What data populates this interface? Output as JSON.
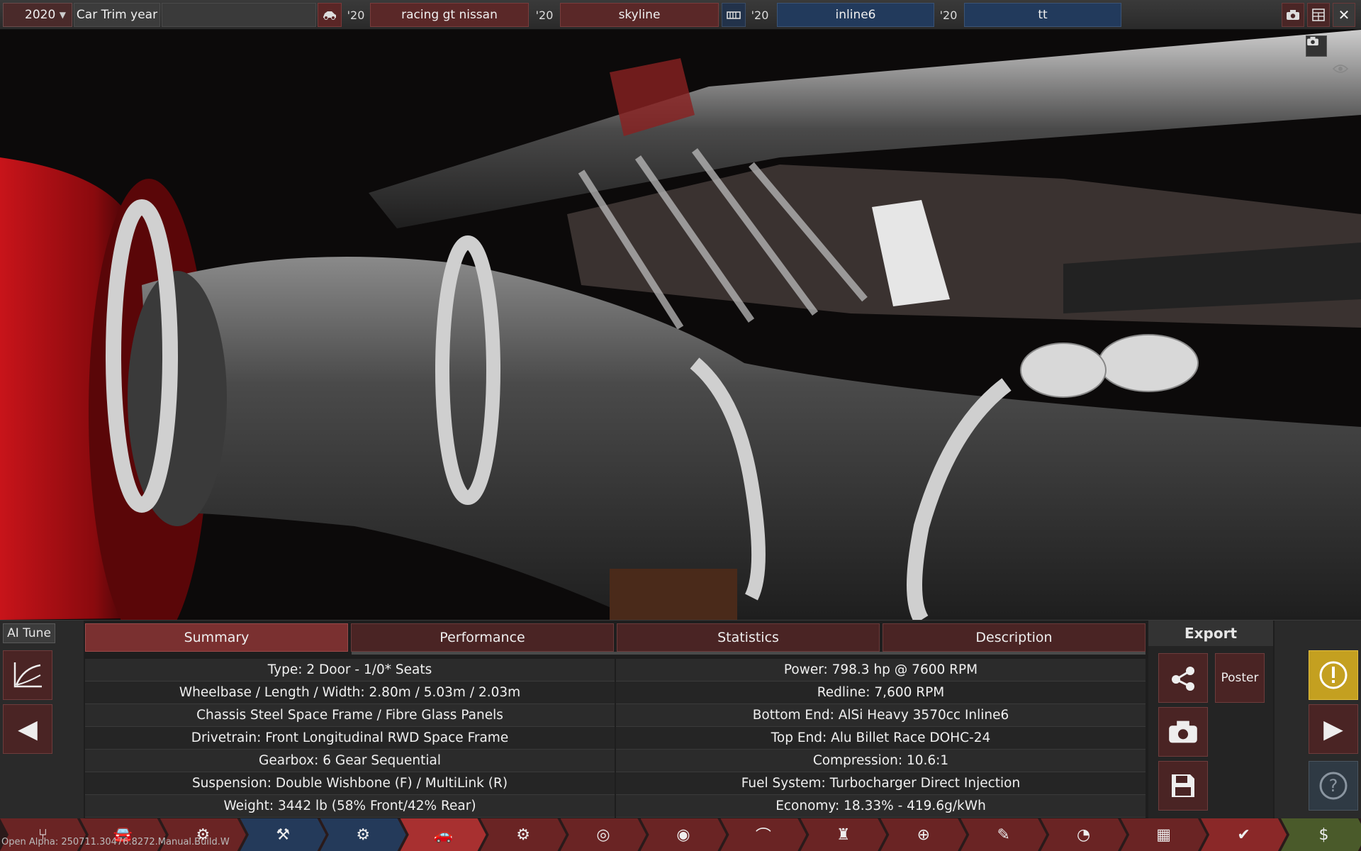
{
  "topbar": {
    "year_value": "2020",
    "field_label": "Car Trim year",
    "model_year_1": "'20",
    "model_name": "racing gt nissan",
    "trim_year_2": "'20",
    "trim_name": "skyline",
    "engine_year_1": "'20",
    "engine_name": "inline6",
    "variant_year": "'20",
    "variant_name": "tt",
    "icons": [
      "car-icon",
      "engine-icon",
      "camera-icon",
      "calculator-icon",
      "close-icon"
    ]
  },
  "scene": {
    "icons": [
      "camera-icon",
      "eye-icon"
    ]
  },
  "panel": {
    "ai_tune_label": "AI Tune",
    "tabs": [
      "Summary",
      "Performance",
      "Statistics",
      "Description"
    ],
    "active_tab": "Summary",
    "left_stats": [
      "Type: 2 Door - 1/0* Seats",
      "Wheelbase / Length / Width: 2.80m / 5.03m / 2.03m",
      "Chassis Steel Space Frame / Fibre Glass Panels",
      "Drivetrain: Front Longitudinal RWD Space Frame",
      "Gearbox: 6 Gear Sequential",
      "Suspension: Double Wishbone (F) / MultiLink (R)",
      "Weight: 3442 lb (58% Front/42% Rear)"
    ],
    "right_stats": [
      "Power: 798.3 hp @ 7600 RPM",
      "Redline:  7,600 RPM",
      "Bottom End: AlSi Heavy 3570cc Inline6",
      "Top End: Alu Billet Race DOHC-24",
      "Compression: 10.6:1",
      "Fuel System: Turbocharger Direct Injection",
      "Economy: 18.33% - 419.6g/kWh"
    ],
    "export_title": "Export",
    "poster_label": "Poster"
  },
  "build_info": "Open Alpha: 250711.30476.8272.Manual.Build.W",
  "colors": {
    "accent_red": "#7a3030",
    "accent_blue": "#223a5c",
    "warning_yellow": "#c4a020"
  }
}
